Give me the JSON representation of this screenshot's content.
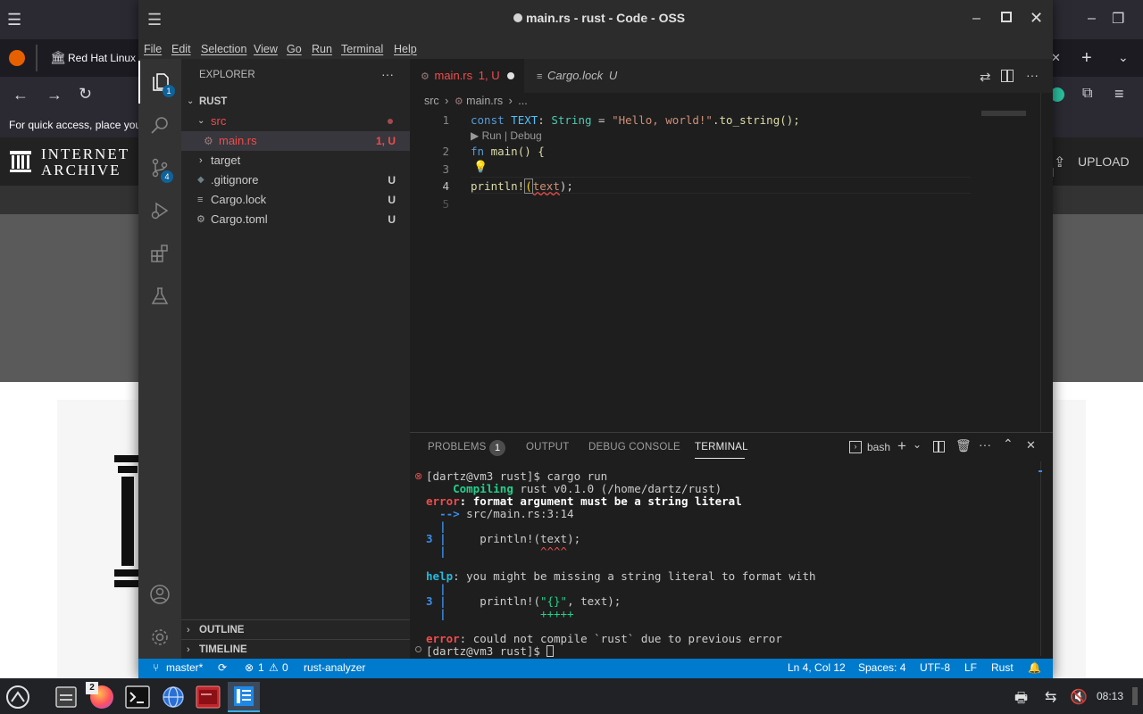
{
  "browser": {
    "tab_title": "Red Hat Linux",
    "bookmarks_hint": "For quick access, place you",
    "ia_logo_line1": "INTERNET",
    "ia_logo_line2": "ARCHIVE",
    "upload_label": "UPLOAD"
  },
  "window": {
    "title": "main.rs - rust - Code - OSS"
  },
  "menu": [
    "File",
    "Edit",
    "Selection",
    "View",
    "Go",
    "Run",
    "Terminal",
    "Help"
  ],
  "activity": {
    "explorer_badge": "1",
    "scm_badge": "4"
  },
  "explorer": {
    "header": "EXPLORER",
    "more": "···",
    "root": "RUST",
    "items": [
      {
        "label": "src",
        "status": ""
      },
      {
        "label": "main.rs",
        "status": "1, U"
      },
      {
        "label": "target",
        "status": ""
      },
      {
        "label": ".gitignore",
        "status": "U"
      },
      {
        "label": "Cargo.lock",
        "status": "U"
      },
      {
        "label": "Cargo.toml",
        "status": "U"
      }
    ],
    "outline": "OUTLINE",
    "timeline": "TIMELINE"
  },
  "tabs": [
    {
      "label": "main.rs",
      "status": "1, U"
    },
    {
      "label": "Cargo.lock",
      "status": "U"
    }
  ],
  "breadcrumb": {
    "folder": "src",
    "file": "main.rs",
    "more": "..."
  },
  "code": {
    "line_numbers": [
      "1",
      "2",
      "3",
      "4",
      "5"
    ],
    "codelens": "▶ Run | Debug",
    "line1_kw": "const",
    "line1_name": "TEXT",
    "line1_type": "String",
    "line1_str": "\"Hello, world!\"",
    "line1_rest": ".to_string();",
    "line2_kw": "fn",
    "line2_rest": "main() {",
    "line4_macro": "println!",
    "line4_arg": "text",
    "line4_end": ");"
  },
  "panel": {
    "tabs": [
      "PROBLEMS",
      "OUTPUT",
      "DEBUG CONSOLE",
      "TERMINAL"
    ],
    "problems_count": "1",
    "shell": "bash"
  },
  "terminal": {
    "prompt1": "[dartz@vm3 rust]$ cargo run",
    "compiling_kw": "Compiling",
    "compiling_rest": "rust v0.1.0 (/home/dartz/rust)",
    "error_kw": "error",
    "error_msg": ": format argument must be a string literal",
    "arrow": "-->",
    "location": "src/main.rs:3:14",
    "pipe": "|",
    "line_no": "3",
    "code_line": "println!(text);",
    "carets": "^^^^",
    "help_kw": "help",
    "help_msg": ": you might be missing a string literal to format with",
    "fix_prefix": "println!(",
    "fix_str": "\"{}\"",
    "fix_suffix": ", text);",
    "plus": "+++++",
    "final_error_msg": ": could not compile `rust` due to previous error",
    "prompt2": "[dartz@vm3 rust]$"
  },
  "status": {
    "branch": "master*",
    "errors": "1",
    "warnings": "0",
    "analyzer": "rust-analyzer",
    "position": "Ln 4, Col 12",
    "spaces": "Spaces: 4",
    "encoding": "UTF-8",
    "eol": "LF",
    "language": "Rust"
  },
  "taskbar": {
    "firefox_windows": "2",
    "clock": "08:13"
  },
  "colors": {
    "status_blue": "#007acc",
    "error_red": "#f14c4c",
    "untracked": "#73c991",
    "modified_orange": "#e2c08d"
  }
}
